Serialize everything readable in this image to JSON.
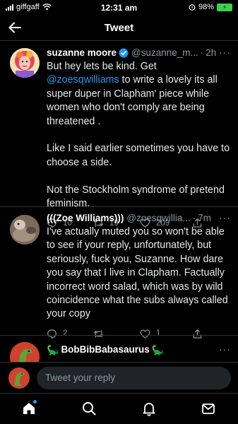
{
  "status": {
    "carrier": "giffgaff",
    "time": "12:31 am",
    "battery": "98%"
  },
  "header": {
    "title": "Tweet"
  },
  "tweets": [
    {
      "name": "suzanne moore",
      "handle": "@suzanne_m...",
      "time": "2h",
      "text_parts": {
        "before": "But hey lets be kind. Get ",
        "mention": "@zoesqwilliams",
        "after": " to write a lovely  its all super duper in Clapham'  piece while women who don't comply are being threatened .\n\nLike I said earlier sometimes you have to choose a side.\n\nNot the Stockholm syndrome of pretend feminism."
      },
      "replies": "10",
      "retweets": "19",
      "likes": "209"
    },
    {
      "name": "(((Zoe Williams)))",
      "handle": "@zoesqwillia...",
      "time": "7m",
      "text": "I've actually muted you so won't be able to see if your reply, unfortunately, but seriously, fuck you, Suzanne. How dare you say that I live in Clapham. Factually incorrect word salad, which was by wild coincidence what the subs always called your copy",
      "replies": "2",
      "retweets": "",
      "likes": "1"
    },
    {
      "name": "BobBibBabasaurus",
      "time": ""
    }
  ],
  "reply_bar": {
    "placeholder": "Tweet your reply"
  },
  "colors": {
    "accent": "#1d9bf0",
    "background": "#000000",
    "secondary_text": "#8b98a5"
  },
  "icons": {
    "nav": [
      "home-icon",
      "search-icon",
      "notifications-icon",
      "messages-icon"
    ]
  }
}
